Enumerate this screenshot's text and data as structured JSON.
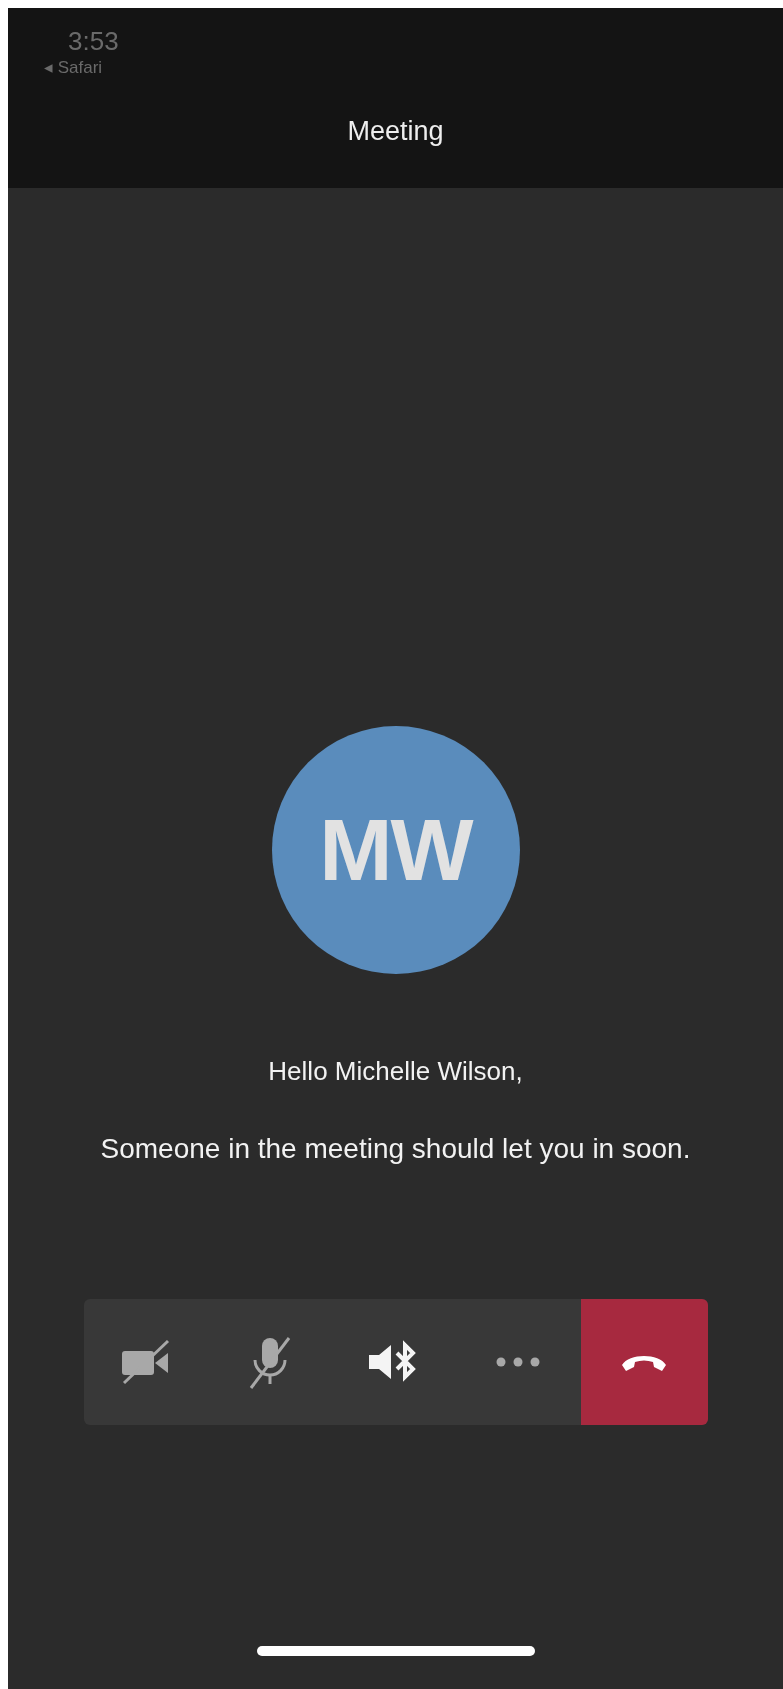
{
  "status_bar": {
    "time": "3:53",
    "back_label": "◂ Safari"
  },
  "header": {
    "title": "Meeting"
  },
  "avatar": {
    "initials": "MW"
  },
  "greeting": "Hello Michelle Wilson,",
  "message": "Someone in the meeting should let you in soon.",
  "controls": [
    {
      "kind": "camera",
      "off": true
    },
    {
      "kind": "mic",
      "off": true
    },
    {
      "kind": "speaker",
      "off": false
    },
    {
      "kind": "more"
    },
    {
      "kind": "hangup"
    }
  ]
}
